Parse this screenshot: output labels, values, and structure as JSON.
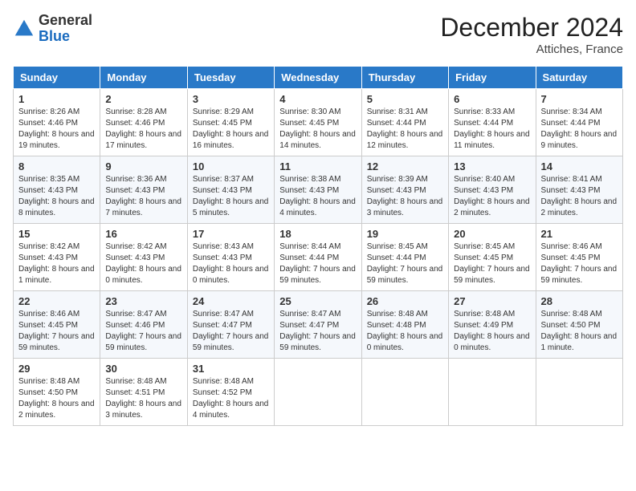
{
  "header": {
    "logo_general": "General",
    "logo_blue": "Blue",
    "title": "December 2024",
    "location": "Attiches, France"
  },
  "weekdays": [
    "Sunday",
    "Monday",
    "Tuesday",
    "Wednesday",
    "Thursday",
    "Friday",
    "Saturday"
  ],
  "weeks": [
    [
      {
        "day": 1,
        "sunrise": "8:26 AM",
        "sunset": "4:46 PM",
        "daylight": "8 hours and 19 minutes."
      },
      {
        "day": 2,
        "sunrise": "8:28 AM",
        "sunset": "4:46 PM",
        "daylight": "8 hours and 17 minutes."
      },
      {
        "day": 3,
        "sunrise": "8:29 AM",
        "sunset": "4:45 PM",
        "daylight": "8 hours and 16 minutes."
      },
      {
        "day": 4,
        "sunrise": "8:30 AM",
        "sunset": "4:45 PM",
        "daylight": "8 hours and 14 minutes."
      },
      {
        "day": 5,
        "sunrise": "8:31 AM",
        "sunset": "4:44 PM",
        "daylight": "8 hours and 12 minutes."
      },
      {
        "day": 6,
        "sunrise": "8:33 AM",
        "sunset": "4:44 PM",
        "daylight": "8 hours and 11 minutes."
      },
      {
        "day": 7,
        "sunrise": "8:34 AM",
        "sunset": "4:44 PM",
        "daylight": "8 hours and 9 minutes."
      }
    ],
    [
      {
        "day": 8,
        "sunrise": "8:35 AM",
        "sunset": "4:43 PM",
        "daylight": "8 hours and 8 minutes."
      },
      {
        "day": 9,
        "sunrise": "8:36 AM",
        "sunset": "4:43 PM",
        "daylight": "8 hours and 7 minutes."
      },
      {
        "day": 10,
        "sunrise": "8:37 AM",
        "sunset": "4:43 PM",
        "daylight": "8 hours and 5 minutes."
      },
      {
        "day": 11,
        "sunrise": "8:38 AM",
        "sunset": "4:43 PM",
        "daylight": "8 hours and 4 minutes."
      },
      {
        "day": 12,
        "sunrise": "8:39 AM",
        "sunset": "4:43 PM",
        "daylight": "8 hours and 3 minutes."
      },
      {
        "day": 13,
        "sunrise": "8:40 AM",
        "sunset": "4:43 PM",
        "daylight": "8 hours and 2 minutes."
      },
      {
        "day": 14,
        "sunrise": "8:41 AM",
        "sunset": "4:43 PM",
        "daylight": "8 hours and 2 minutes."
      }
    ],
    [
      {
        "day": 15,
        "sunrise": "8:42 AM",
        "sunset": "4:43 PM",
        "daylight": "8 hours and 1 minute."
      },
      {
        "day": 16,
        "sunrise": "8:42 AM",
        "sunset": "4:43 PM",
        "daylight": "8 hours and 0 minutes."
      },
      {
        "day": 17,
        "sunrise": "8:43 AM",
        "sunset": "4:43 PM",
        "daylight": "8 hours and 0 minutes."
      },
      {
        "day": 18,
        "sunrise": "8:44 AM",
        "sunset": "4:44 PM",
        "daylight": "7 hours and 59 minutes."
      },
      {
        "day": 19,
        "sunrise": "8:45 AM",
        "sunset": "4:44 PM",
        "daylight": "7 hours and 59 minutes."
      },
      {
        "day": 20,
        "sunrise": "8:45 AM",
        "sunset": "4:45 PM",
        "daylight": "7 hours and 59 minutes."
      },
      {
        "day": 21,
        "sunrise": "8:46 AM",
        "sunset": "4:45 PM",
        "daylight": "7 hours and 59 minutes."
      }
    ],
    [
      {
        "day": 22,
        "sunrise": "8:46 AM",
        "sunset": "4:45 PM",
        "daylight": "7 hours and 59 minutes."
      },
      {
        "day": 23,
        "sunrise": "8:47 AM",
        "sunset": "4:46 PM",
        "daylight": "7 hours and 59 minutes."
      },
      {
        "day": 24,
        "sunrise": "8:47 AM",
        "sunset": "4:47 PM",
        "daylight": "7 hours and 59 minutes."
      },
      {
        "day": 25,
        "sunrise": "8:47 AM",
        "sunset": "4:47 PM",
        "daylight": "7 hours and 59 minutes."
      },
      {
        "day": 26,
        "sunrise": "8:48 AM",
        "sunset": "4:48 PM",
        "daylight": "8 hours and 0 minutes."
      },
      {
        "day": 27,
        "sunrise": "8:48 AM",
        "sunset": "4:49 PM",
        "daylight": "8 hours and 0 minutes."
      },
      {
        "day": 28,
        "sunrise": "8:48 AM",
        "sunset": "4:50 PM",
        "daylight": "8 hours and 1 minute."
      }
    ],
    [
      {
        "day": 29,
        "sunrise": "8:48 AM",
        "sunset": "4:50 PM",
        "daylight": "8 hours and 2 minutes."
      },
      {
        "day": 30,
        "sunrise": "8:48 AM",
        "sunset": "4:51 PM",
        "daylight": "8 hours and 3 minutes."
      },
      {
        "day": 31,
        "sunrise": "8:48 AM",
        "sunset": "4:52 PM",
        "daylight": "8 hours and 4 minutes."
      },
      null,
      null,
      null,
      null
    ]
  ]
}
